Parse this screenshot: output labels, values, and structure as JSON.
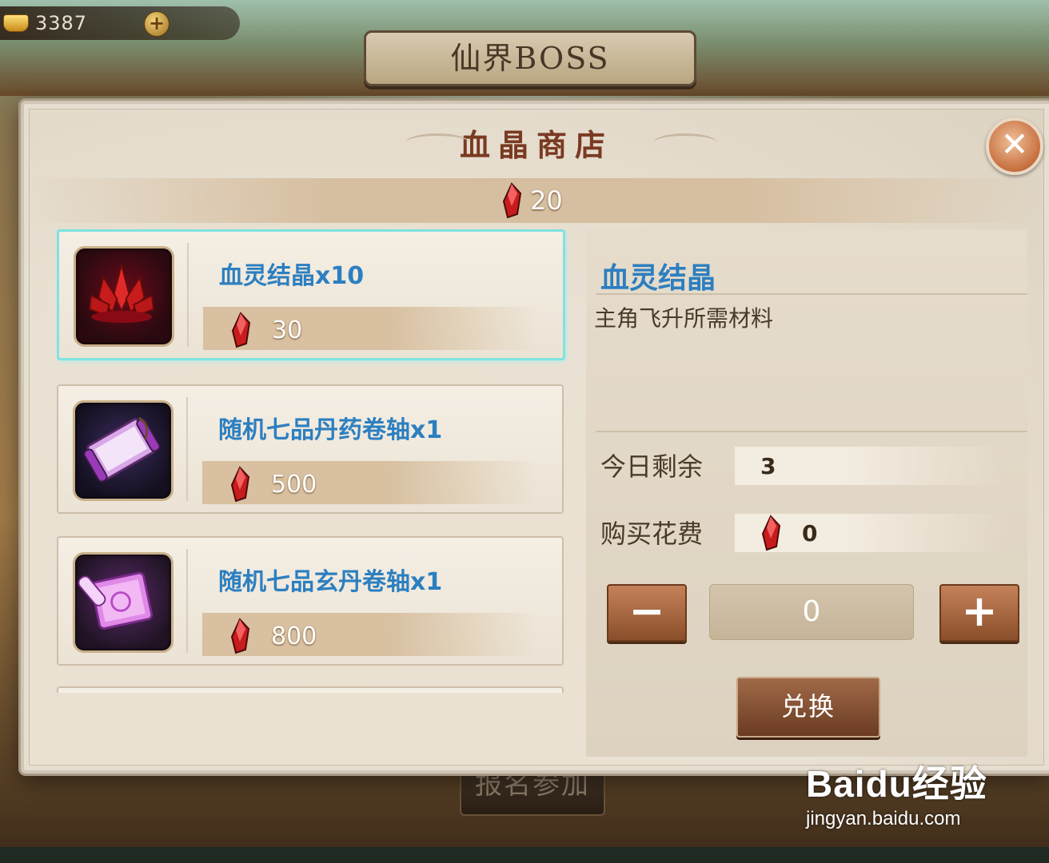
{
  "header": {
    "currency_amount": "3387",
    "currency_plus": "+",
    "scene_title": "仙界BOSS"
  },
  "shop": {
    "title": "血晶商店",
    "close_symbol": "✕",
    "balance": "20",
    "items": [
      {
        "name": "血灵结晶x10",
        "price": "30",
        "icon": "red-crystal-icon"
      },
      {
        "name": "随机七品丹药卷轴x1",
        "price": "500",
        "icon": "purple-scroll-icon"
      },
      {
        "name": "随机七品玄丹卷轴x1",
        "price": "800",
        "icon": "pink-scroll-icon"
      }
    ],
    "detail": {
      "title": "血灵结晶",
      "description": "主角飞升所需材料",
      "remaining_label": "今日剩余",
      "remaining_value": "3",
      "cost_label": "购买花费",
      "cost_value": "0",
      "minus_symbol": "−",
      "plus_symbol": "+",
      "quantity": "0",
      "exchange_label": "兑换"
    }
  },
  "background": {
    "register_label": "报名参加"
  },
  "watermark": {
    "logo": "Baidu经验",
    "url": "jingyan.baidu.com"
  },
  "colors": {
    "item_name": "#2c7fc0",
    "selected_border": "#7fe3e0",
    "dialog_title": "#7a3a22"
  }
}
